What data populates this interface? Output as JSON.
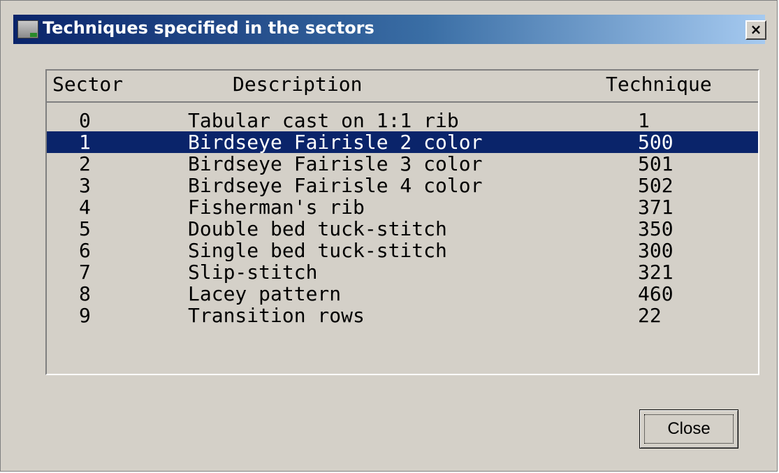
{
  "window": {
    "title": "Techniques specified in the sectors",
    "close_glyph": "×"
  },
  "list": {
    "headers": {
      "sector": "Sector",
      "description": "Description",
      "technique": "Technique"
    },
    "rows": [
      {
        "sector": "0",
        "description": "Tabular cast on 1:1 rib",
        "technique": "1"
      },
      {
        "sector": "1",
        "description": "Birdseye Fairisle 2 color",
        "technique": "500"
      },
      {
        "sector": "2",
        "description": "Birdseye Fairisle 3 color",
        "technique": "501"
      },
      {
        "sector": "3",
        "description": "Birdseye Fairisle 4 color",
        "technique": "502"
      },
      {
        "sector": "4",
        "description": "Fisherman's rib",
        "technique": "371"
      },
      {
        "sector": "5",
        "description": "Double bed tuck-stitch",
        "technique": "350"
      },
      {
        "sector": "6",
        "description": "Single bed tuck-stitch",
        "technique": "300"
      },
      {
        "sector": "7",
        "description": "Slip-stitch",
        "technique": "321"
      },
      {
        "sector": "8",
        "description": "Lacey pattern",
        "technique": "460"
      },
      {
        "sector": "9",
        "description": "Transition rows",
        "technique": "22"
      }
    ],
    "selected_sector": "1"
  },
  "buttons": {
    "close_label": "Close"
  },
  "colors": {
    "selection": "#0a246a",
    "dialog_bg": "#d4d0c8"
  }
}
